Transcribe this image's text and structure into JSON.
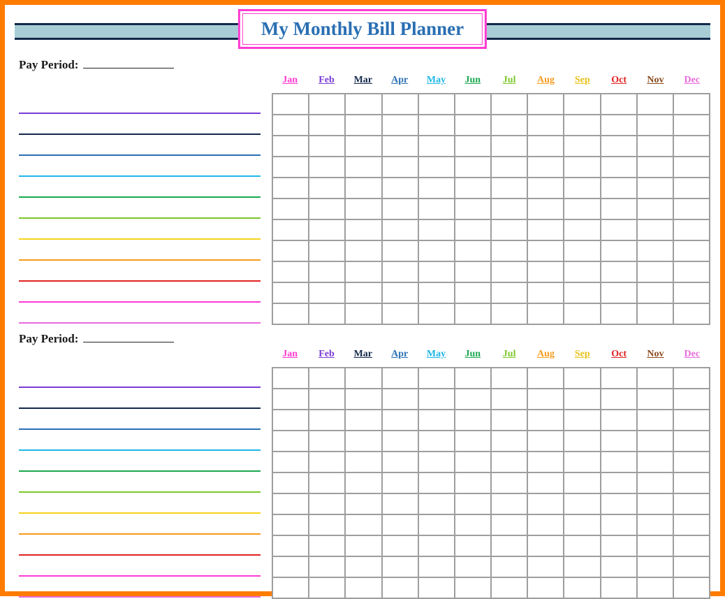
{
  "title": "My Monthly Bill Planner",
  "pay_period_label": "Pay Period:",
  "months": [
    {
      "label": "Jan",
      "color": "#ff3bd1"
    },
    {
      "label": "Feb",
      "color": "#7a3bd6"
    },
    {
      "label": "Mar",
      "color": "#13284b"
    },
    {
      "label": "Apr",
      "color": "#2a6fb3"
    },
    {
      "label": "May",
      "color": "#1fb7e6"
    },
    {
      "label": "Jun",
      "color": "#1aa84f"
    },
    {
      "label": "Jul",
      "color": "#7cc62a"
    },
    {
      "label": "Aug",
      "color": "#f59b1e"
    },
    {
      "label": "Sep",
      "color": "#e7c21b"
    },
    {
      "label": "Oct",
      "color": "#e22121"
    },
    {
      "label": "Nov",
      "color": "#8a4a1e"
    },
    {
      "label": "Dec",
      "color": "#e86bdc"
    }
  ],
  "row_colors": [
    "#7a3bd6",
    "#13284b",
    "#2a6fb3",
    "#1fb7e6",
    "#1aa84f",
    "#7cc62a",
    "#f5d21b",
    "#f59b1e",
    "#e22121",
    "#ff3bd1",
    "#e86bdc"
  ],
  "sections": 2,
  "rows_per_section": 11
}
